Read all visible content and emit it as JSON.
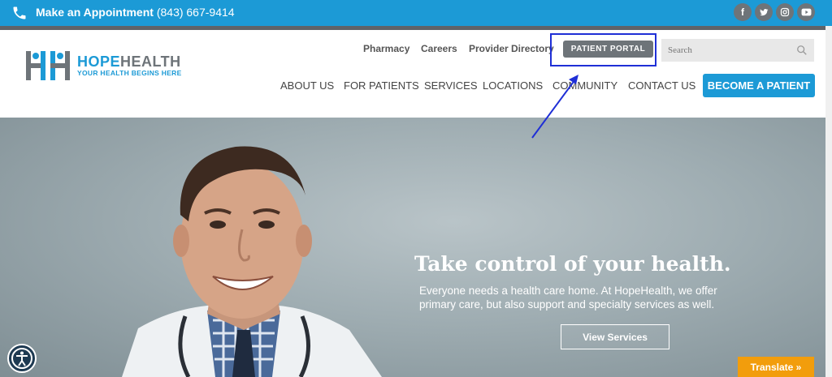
{
  "topbar": {
    "appointment_label": "Make an Appointment",
    "appointment_phone": "(843) 667-9414",
    "social": [
      "f",
      "t",
      "i",
      "y"
    ]
  },
  "logo": {
    "name_hope": "HOPE",
    "name_health": "HEALTH",
    "tagline": "YOUR HEALTH BEGINS HERE"
  },
  "utility_nav": {
    "pharmacy": "Pharmacy",
    "careers": "Careers",
    "provider_directory": "Provider Directory",
    "patient_portal": "PATIENT PORTAL"
  },
  "search": {
    "placeholder": "Search"
  },
  "main_nav": {
    "about": "ABOUT US",
    "patients": "FOR PATIENTS",
    "services": "SERVICES",
    "locations": "LOCATIONS",
    "community": "COMMUNITY",
    "contact": "CONTACT US",
    "become": "BECOME A PATIENT"
  },
  "hero": {
    "title": "Take control of your health.",
    "line1": "Everyone needs a health care home. At HopeHealth, we offer",
    "line2": "primary care, but also support and specialty services as well.",
    "button": "View Services"
  },
  "widgets": {
    "translate": "Translate »"
  },
  "colors": {
    "brand_blue": "#1c9ad6",
    "brand_grey": "#6e7479",
    "translate_orange": "#f29d0c",
    "annotation_blue": "#1f2fd6"
  }
}
